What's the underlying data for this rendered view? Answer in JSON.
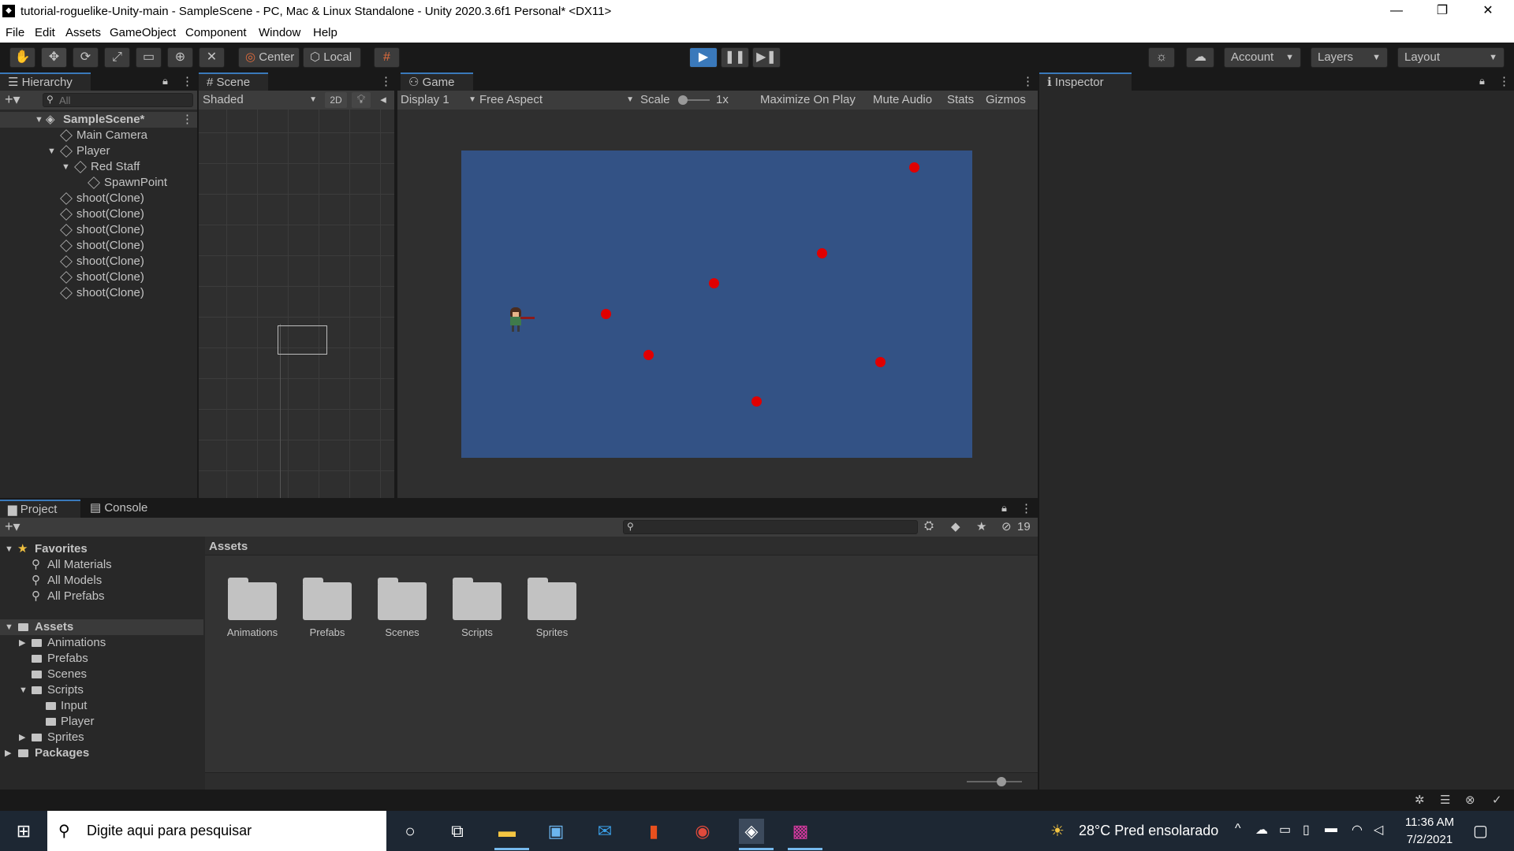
{
  "window": {
    "title": "tutorial-roguelike-Unity-main - SampleScene - PC, Mac & Linux Standalone - Unity 2020.3.6f1 Personal* <DX11>",
    "minimize": "—",
    "restore": "❐",
    "close": "✕"
  },
  "menu": [
    "File",
    "Edit",
    "Assets",
    "GameObject",
    "Component",
    "Window",
    "Help"
  ],
  "toolbar": {
    "center": "Center",
    "local": "Local",
    "account": "Account",
    "layers": "Layers",
    "layout": "Layout"
  },
  "hierarchy": {
    "tab": "Hierarchy",
    "search_placeholder": "All",
    "scene": "SampleScene*",
    "items": [
      "Main Camera",
      "Player",
      "Red Staff",
      "SpawnPoint",
      "shoot(Clone)",
      "shoot(Clone)",
      "shoot(Clone)",
      "shoot(Clone)",
      "shoot(Clone)",
      "shoot(Clone)",
      "shoot(Clone)"
    ]
  },
  "scene": {
    "tab": "Scene",
    "shading": "Shaded",
    "mode2d": "2D"
  },
  "game": {
    "tab": "Game",
    "display": "Display 1",
    "aspect": "Free Aspect",
    "scale_label": "Scale",
    "scale_value": "1x",
    "maximize": "Maximize On Play",
    "mute": "Mute Audio",
    "stats": "Stats",
    "gizmos": "Gizmos",
    "background": "#335285",
    "projectile_color": "#e00000"
  },
  "inspector": {
    "tab": "Inspector"
  },
  "project": {
    "tab_project": "Project",
    "tab_console": "Console",
    "hidden_count": "19",
    "favorites": "Favorites",
    "fav_items": [
      "All Materials",
      "All Models",
      "All Prefabs"
    ],
    "assets_root": "Assets",
    "tree": [
      "Animations",
      "Prefabs",
      "Scenes",
      "Scripts",
      "Input",
      "Player",
      "Sprites"
    ],
    "packages": "Packages",
    "breadcrumb": "Assets",
    "folders": [
      "Animations",
      "Prefabs",
      "Scenes",
      "Scripts",
      "Sprites"
    ]
  },
  "taskbar": {
    "search": "Digite aqui para pesquisar",
    "weather": "28°C  Pred ensolarado",
    "time": "11:36 AM",
    "date": "7/2/2021"
  }
}
